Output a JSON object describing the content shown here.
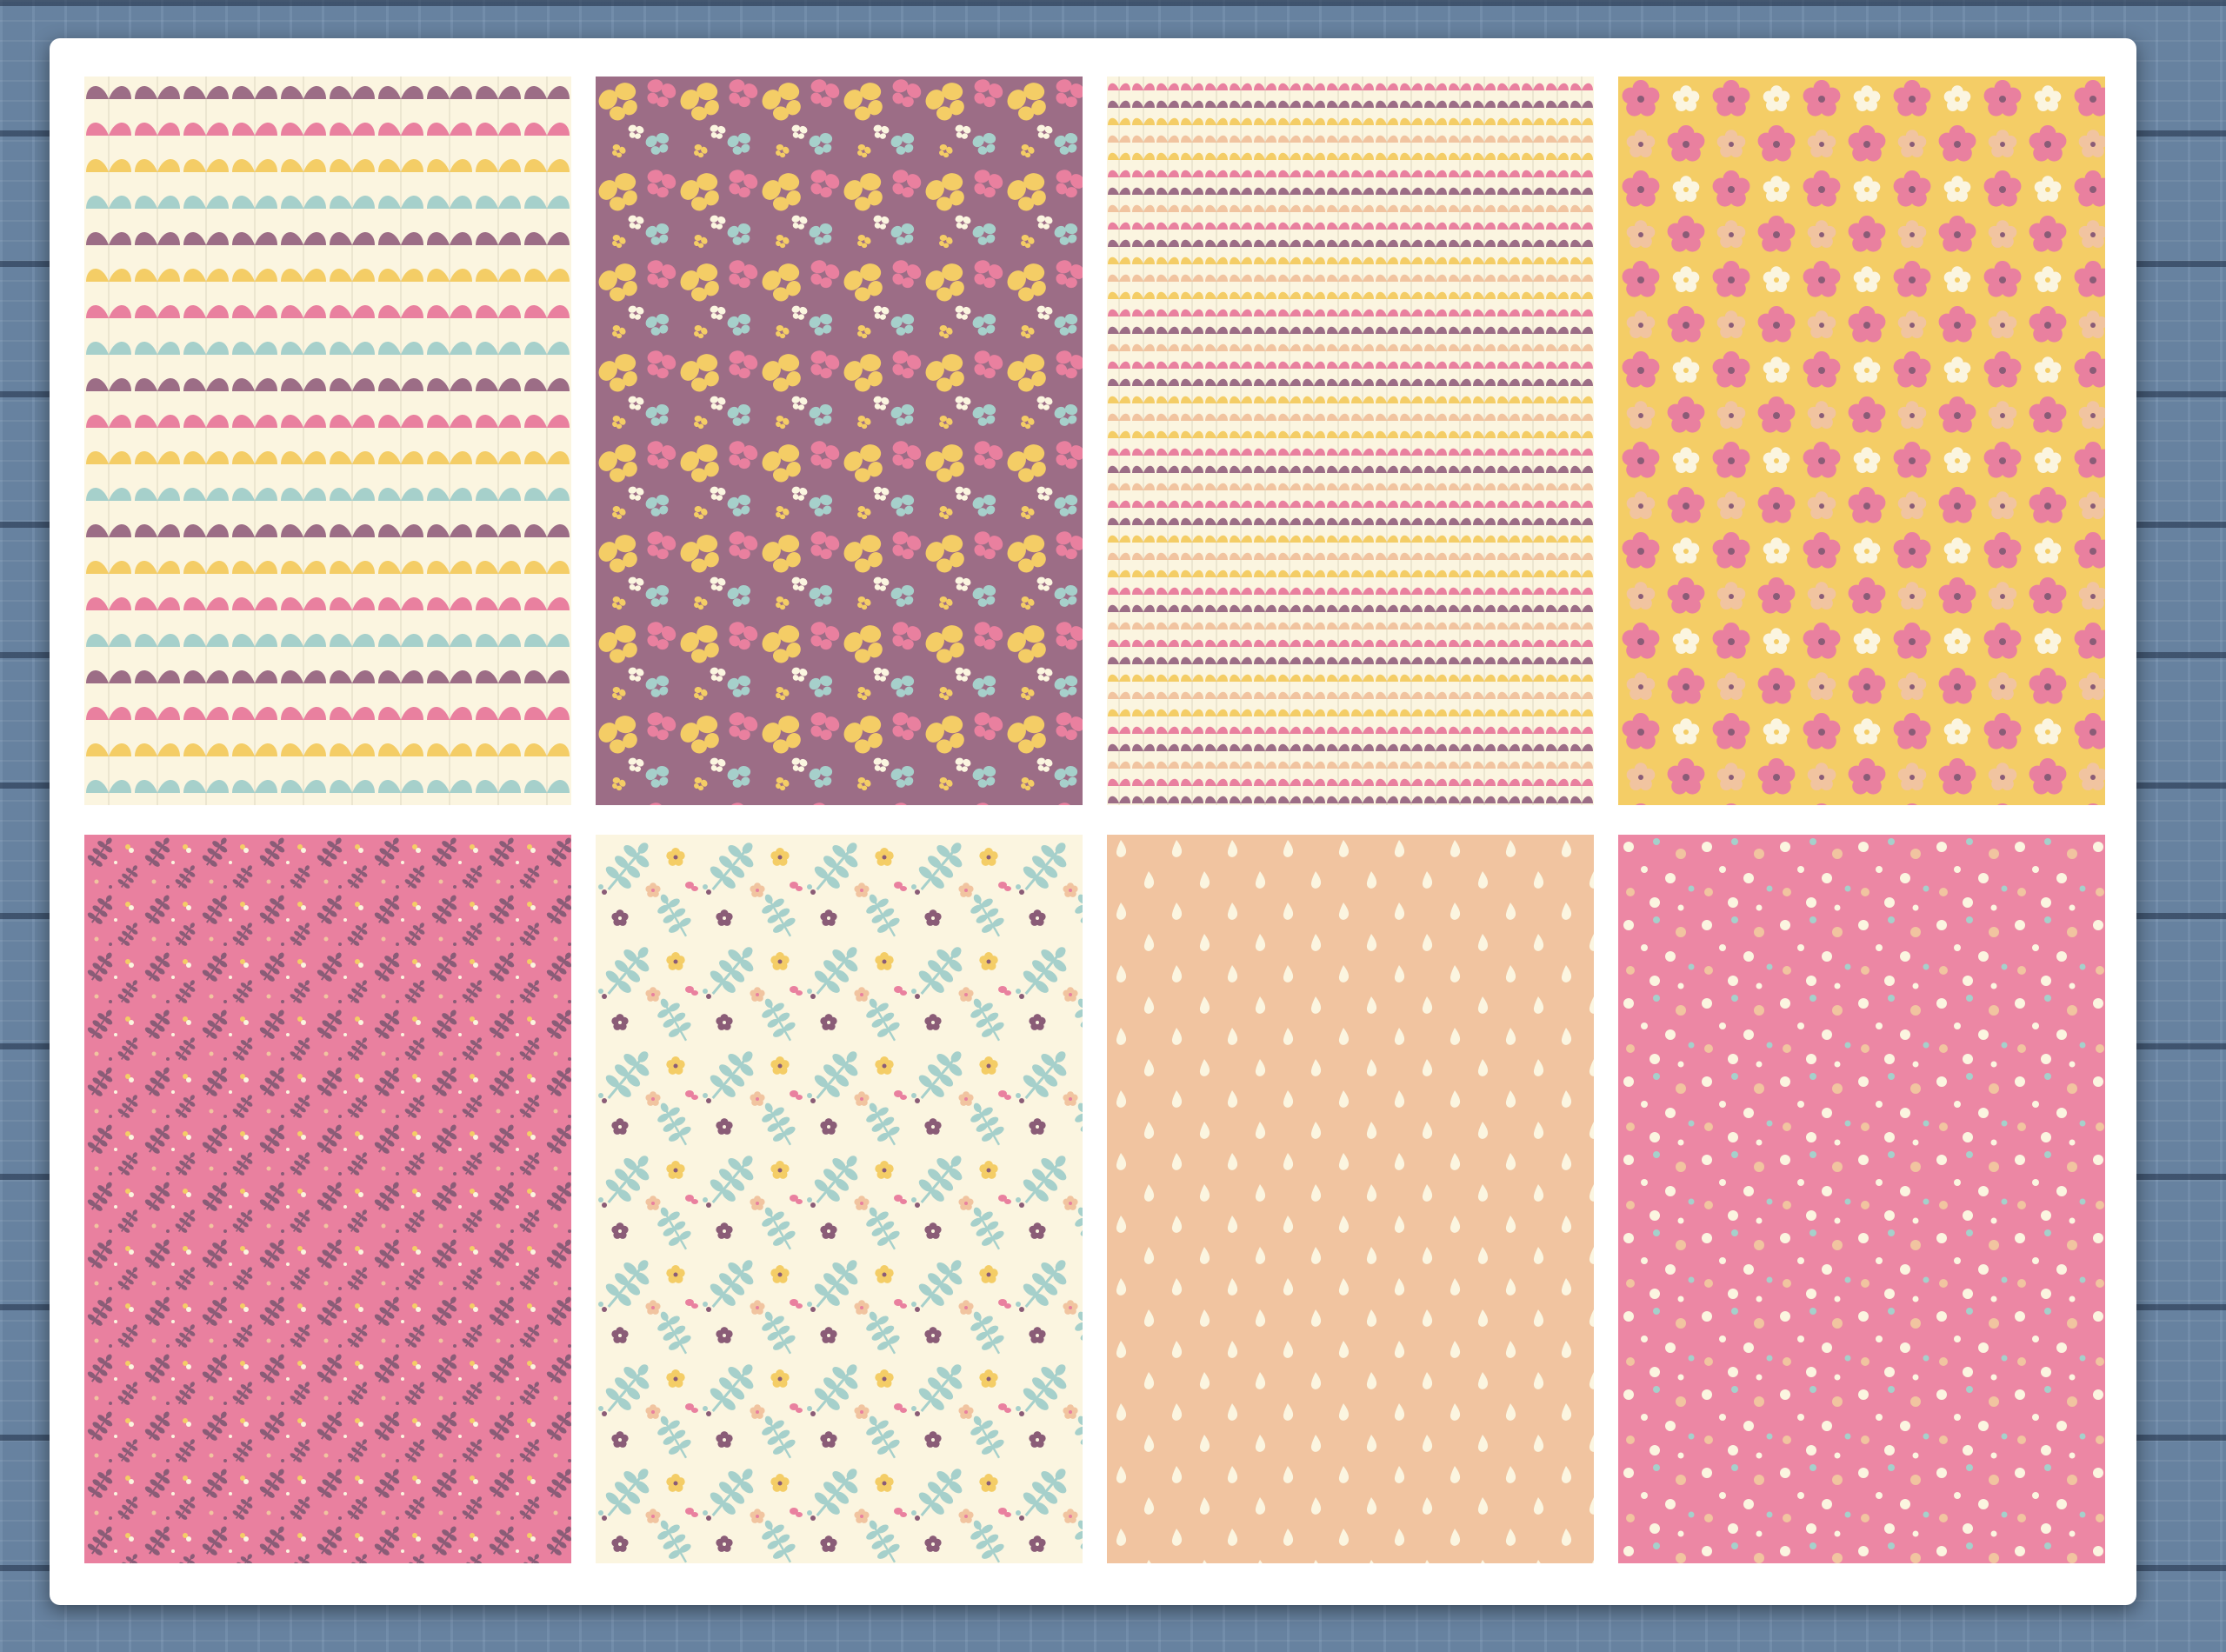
{
  "colors": {
    "cream": "#fbf5e0",
    "plum": "#9c6d86",
    "plum_dark": "#8a5c77",
    "pink": "#e9809f",
    "pink_light": "#ef9cb5",
    "yellow": "#f4cd66",
    "aqua": "#a6d0cb",
    "peach": "#f1c4a0"
  },
  "patterns": [
    {
      "name": "leaf-rows-pattern",
      "background": "#fbf5e0"
    },
    {
      "name": "butterflies-pattern",
      "background": "#9c6d86"
    },
    {
      "name": "small-leaf-rows-pattern",
      "background": "#fbf5e0"
    },
    {
      "name": "flowers-pattern",
      "background": "#f4cd66"
    },
    {
      "name": "sprigs-pattern",
      "background": "#e9809f"
    },
    {
      "name": "botanical-pattern",
      "background": "#fbf5e0"
    },
    {
      "name": "raindrops-pattern",
      "background": "#f1c4a0"
    },
    {
      "name": "polka-dots-pattern",
      "background": "#ec87a4"
    }
  ]
}
